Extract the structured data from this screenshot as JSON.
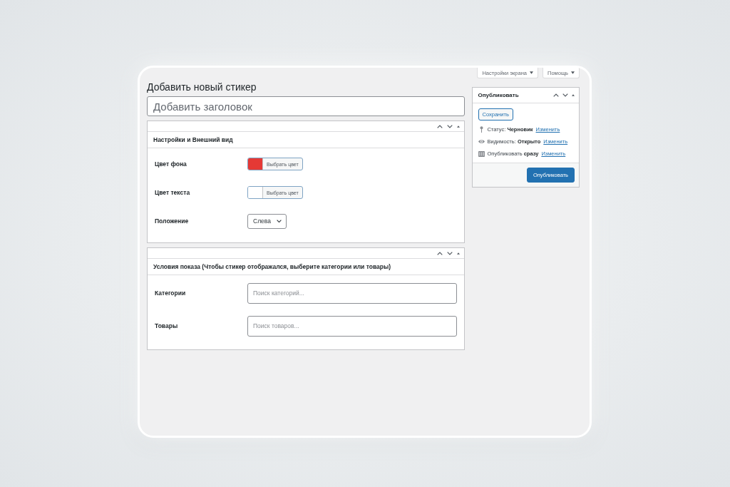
{
  "header_buttons": [
    {
      "label": "Настройки экрана"
    },
    {
      "label": "Помощь"
    }
  ],
  "page_title": "Добавить новый стикер",
  "title_field": {
    "placeholder": "Добавить заголовок"
  },
  "metaboxes": [
    {
      "title": "Настройки и Внешний вид",
      "fields": [
        {
          "kind": "color",
          "label": "Цвет фона",
          "button": "Выбрать цвет",
          "color": "#e53935"
        },
        {
          "kind": "color",
          "label": "Цвет текста",
          "button": "Выбрать цвет",
          "color": "#ffffff"
        },
        {
          "kind": "select",
          "label": "Положение",
          "value": "Слева"
        }
      ]
    },
    {
      "title": "Условия показа (Чтобы стикер отображался, выберите категории или товары)",
      "fields": [
        {
          "kind": "search",
          "label": "Категории",
          "placeholder": "Поиск категорий..."
        },
        {
          "kind": "search",
          "label": "Товары",
          "placeholder": "Поиск товаров..."
        }
      ]
    }
  ],
  "publish_box": {
    "title": "Опубликовать",
    "save_button": "Сохранить",
    "rows": [
      {
        "kind": "status",
        "text": "Статус: **Черновик**",
        "link": "Изменить"
      },
      {
        "kind": "visibility",
        "text": "Видимость: **Открыто**",
        "link": "Изменить"
      },
      {
        "kind": "schedule",
        "text": "Опубликовать **сразу**",
        "link": "Изменить"
      }
    ],
    "publish_button": "Опубликовать"
  }
}
